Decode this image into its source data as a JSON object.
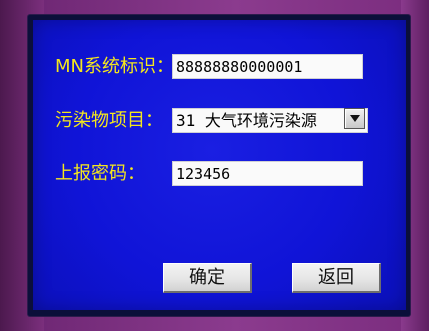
{
  "form": {
    "mn_label": "MN系统标识：",
    "mn_value": "88888880000001",
    "pollutant_label": "污染物项目：",
    "pollutant_value": "31 大气环境污染源",
    "password_label": "上报密码：",
    "password_value": "123456"
  },
  "buttons": {
    "confirm": "确定",
    "back": "返回"
  },
  "icons": {
    "dropdown": "chevron-down-icon"
  },
  "colors": {
    "screen_background": "#1014d7",
    "label_text": "#f4e71d",
    "input_background": "#fafafa",
    "device_frame": "#8b3b8e"
  }
}
